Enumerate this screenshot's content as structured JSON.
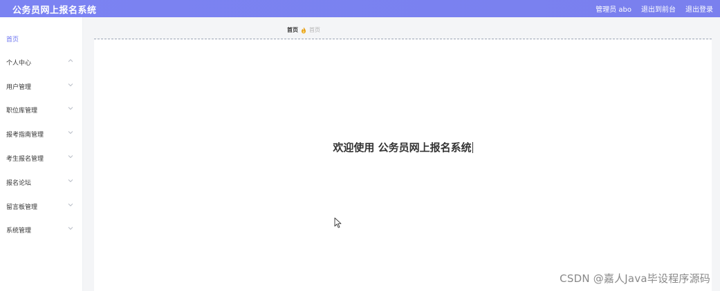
{
  "app": {
    "title": "公务员网上报名系统"
  },
  "topbar": {
    "user": "管理员 abo",
    "to_frontend": "退出到前台",
    "logout": "退出登录"
  },
  "sidebar": {
    "items": [
      {
        "label": "首页",
        "active": true,
        "has_chevron": false
      },
      {
        "label": "个人中心",
        "active": false,
        "has_chevron": true,
        "chevron": "up"
      },
      {
        "label": "用户管理",
        "active": false,
        "has_chevron": true,
        "chevron": "down"
      },
      {
        "label": "职位库管理",
        "active": false,
        "has_chevron": true,
        "chevron": "down"
      },
      {
        "label": "报考指南管理",
        "active": false,
        "has_chevron": true,
        "chevron": "down"
      },
      {
        "label": "考生报名管理",
        "active": false,
        "has_chevron": true,
        "chevron": "down"
      },
      {
        "label": "报名论坛",
        "active": false,
        "has_chevron": true,
        "chevron": "down"
      },
      {
        "label": "留言板管理",
        "active": false,
        "has_chevron": true,
        "chevron": "down"
      },
      {
        "label": "系统管理",
        "active": false,
        "has_chevron": true,
        "chevron": "down"
      }
    ]
  },
  "breadcrumb": {
    "home": "首页",
    "separator_icon": "flame-icon",
    "current": "首页"
  },
  "main": {
    "welcome": "欢迎使用 公务员网上报名系统"
  },
  "watermark": "CSDN @嘉人Java毕设程序源码",
  "colors": {
    "accent": "#7b83f2",
    "active_menu": "#6b73f0"
  }
}
